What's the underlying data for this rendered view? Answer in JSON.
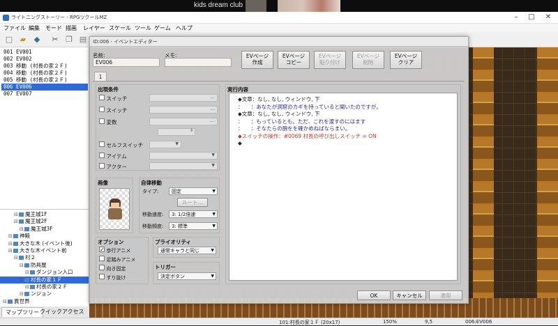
{
  "topstrip": {
    "label": "kids dream club"
  },
  "titlebar": {
    "title": "ライトニングストーリー - RPGツクールMZ"
  },
  "menubar": [
    "ファイル",
    "編集",
    "モード",
    "描画",
    "レイヤー",
    "スケール",
    "ツール",
    "ゲーム",
    "ヘルプ"
  ],
  "event_list": [
    {
      "label": "001 EV001",
      "selected": false
    },
    {
      "label": "002 EV002",
      "selected": false
    },
    {
      "label": "003 移動 (村長の家２Ｆ)",
      "selected": false
    },
    {
      "label": "004 移動 (村長の家２Ｆ)",
      "selected": false
    },
    {
      "label": "005 移動 (村長の家２Ｆ)",
      "selected": false
    },
    {
      "label": "006 EV006",
      "selected": true
    },
    {
      "label": "007 EV007",
      "selected": false
    }
  ],
  "map_tree": [
    {
      "label": "魔王城1F",
      "indent": 2,
      "selected": false
    },
    {
      "label": "魔王城2F",
      "indent": 2,
      "selected": false
    },
    {
      "label": "魔王城3F",
      "indent": 3,
      "selected": false
    },
    {
      "label": "神殿",
      "indent": 1,
      "selected": false
    },
    {
      "label": "大きな木 (イベント後)",
      "indent": 1,
      "selected": false
    },
    {
      "label": "大きな木イベント前",
      "indent": 1,
      "selected": false
    },
    {
      "label": "村２",
      "indent": 2,
      "selected": false
    },
    {
      "label": "防具屋",
      "indent": 3,
      "selected": false
    },
    {
      "label": "ダンジョン入口",
      "indent": 4,
      "selected": false
    },
    {
      "label": "村長の家１Ｆ",
      "indent": 3,
      "selected": true
    },
    {
      "label": "村長の家２Ｆ",
      "indent": 4,
      "selected": false
    },
    {
      "label": "ンジョン",
      "indent": 3,
      "selected": false
    },
    {
      "label": "異世界",
      "indent": 0,
      "selected": false
    }
  ],
  "tabs": {
    "map_tree": "マップツリー",
    "quick_access": "クイックアクセス"
  },
  "status": {
    "map": "101:村長の家１Ｆ (20x17)",
    "zoom": "150%",
    "coords": "9,5",
    "event": "006:EV006"
  },
  "dialog": {
    "title": "ID:006 - イベントエディター",
    "name_label": "名前:",
    "name_value": "EV006",
    "memo_label": "メモ:",
    "memo_value": "",
    "buttons": [
      {
        "line1": "EVページ",
        "line2": "作成",
        "enabled": true
      },
      {
        "line1": "EVページ",
        "line2": "コピー",
        "enabled": true
      },
      {
        "line1": "EVページ",
        "line2": "貼り付け",
        "enabled": false
      },
      {
        "line1": "EVページ",
        "line2": "削除",
        "enabled": false
      },
      {
        "line1": "EVページ",
        "line2": "クリア",
        "enabled": true
      }
    ],
    "page_tab": "1",
    "conditions": {
      "header": "出現条件",
      "switch1": "スイッチ",
      "switch2": "スイッチ",
      "variable": "変数",
      "self_switch": "セルフスイッチ",
      "item": "アイテム",
      "actor": "アクター",
      "ellipsis": "..."
    },
    "image": {
      "header": "画像"
    },
    "autonomous": {
      "header": "自律移動",
      "type_label": "タイプ:",
      "type_value": "固定",
      "route_button": "ルート...",
      "speed_label": "移動速度:",
      "speed_value": "3: 1/2倍速",
      "freq_label": "移動頻度:",
      "freq_value": "3: 標準"
    },
    "options": {
      "header": "オプション",
      "walk_anim": "歩行アニメ",
      "walk_anim_checked": true,
      "step_anim": "足踏みアニメ",
      "dir_fix": "向き固定",
      "through": "すり抜け"
    },
    "priority": {
      "header": "プライオリティ",
      "value": "通常キャラと同じ"
    },
    "trigger": {
      "header": "トリガー",
      "value": "決定ボタン"
    },
    "contents": {
      "header": "実行内容",
      "lines": [
        {
          "text": "◆文章：なし, なし, ウィンドウ, 下",
          "color": "#222222"
        },
        {
          "text": "：　　：あなたが洞窟のカギを持っていると聞いたのですが。",
          "color": "#2a2a8a"
        },
        {
          "text": "◆文章：なし, なし, ウィンドウ, 下",
          "color": "#222222"
        },
        {
          "text": "：　　：もっているとも。ただ、これを渡すのにはます",
          "color": "#2a2a8a"
        },
        {
          "text": "：　　：そなたらの腕をを確かめねばならまい。",
          "color": "#2a2a8a"
        },
        {
          "text": "◆スイッチの操作：#0069 村長の呼び出しスイッチ = ON",
          "color": "#c0392b"
        },
        {
          "text": "◆",
          "color": "#222222"
        }
      ]
    },
    "footer": {
      "ok": "OK",
      "cancel": "キャンセル",
      "apply": "適用"
    }
  }
}
